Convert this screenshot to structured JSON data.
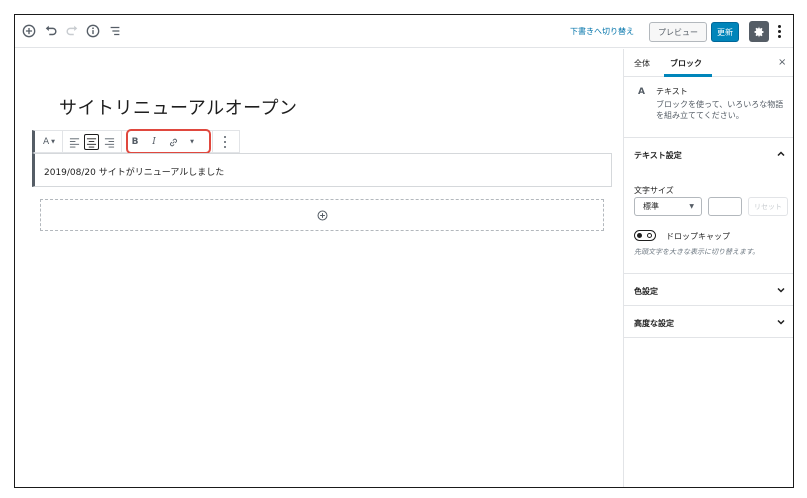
{
  "topbar": {
    "icons": [
      "add-block-icon",
      "undo-icon",
      "redo-icon",
      "info-icon",
      "outline-icon"
    ],
    "draft_link": "下書きへ切り替え",
    "preview_label": "プレビュー",
    "update_label": "更新"
  },
  "editor": {
    "post_title": "サイトリニューアルオープン",
    "toolbar": {
      "block_type_label": "A",
      "bold_label": "B",
      "italic_label": "I"
    },
    "paragraph_text": "2019/08/20 サイトがリニューアルしました"
  },
  "sidebar": {
    "tabs": [
      "全体",
      "ブロック"
    ],
    "close_label": "×",
    "block_card": {
      "icon_label": "A",
      "title": "テキスト",
      "description": "ブロックを使って、いろいろな物語を組み立ててください。"
    },
    "text_settings": {
      "title": "テキスト設定",
      "font_size_label": "文字サイズ",
      "font_size_value": "標準",
      "reset_label": "リセット",
      "dropcap_label": "ドロップキャップ",
      "dropcap_help": "先頭文字を大きな表示に切り替えます。"
    },
    "color_settings_title": "色設定",
    "advanced_settings_title": "高度な設定"
  },
  "colors": {
    "accent": "#0085ba",
    "link": "#0073aa",
    "highlight": "#e0483e"
  }
}
